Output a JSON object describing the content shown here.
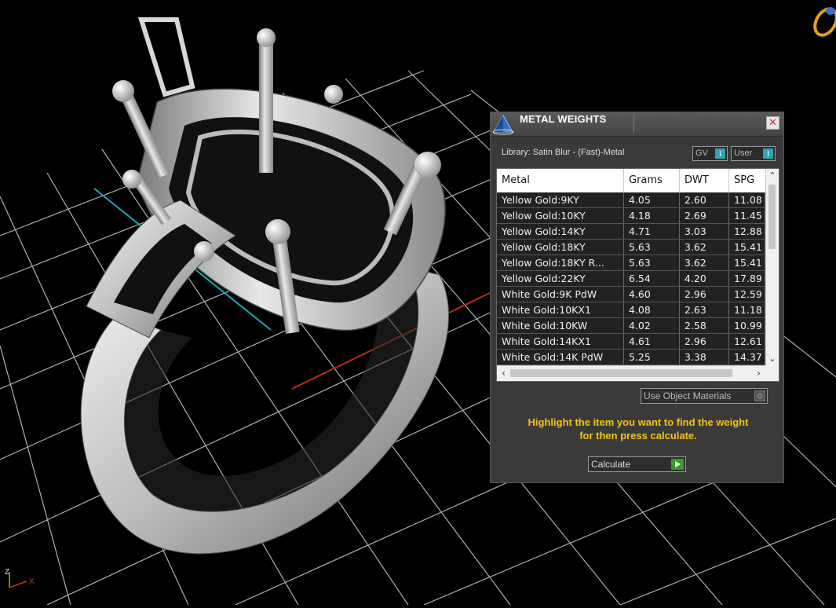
{
  "panel": {
    "title": "METAL WEIGHTS",
    "close_label": "✕",
    "library_label": "Library: Satin Blur - (Fast)-Metal",
    "gv_label": "GV",
    "user_label": "User",
    "columns": [
      "Metal",
      "Grams",
      "DWT",
      "SPG"
    ],
    "rows": [
      {
        "metal": "Yellow Gold:9KY",
        "grams": "4.05",
        "dwt": "2.60",
        "spg": "11.08"
      },
      {
        "metal": "Yellow Gold:10KY",
        "grams": "4.18",
        "dwt": "2.69",
        "spg": "11.45"
      },
      {
        "metal": "Yellow Gold:14KY",
        "grams": "4.71",
        "dwt": "3.03",
        "spg": "12.88"
      },
      {
        "metal": "Yellow Gold:18KY",
        "grams": "5.63",
        "dwt": "3.62",
        "spg": "15.41"
      },
      {
        "metal": "Yellow Gold:18KY R...",
        "grams": "5.63",
        "dwt": "3.62",
        "spg": "15.41"
      },
      {
        "metal": "Yellow Gold:22KY",
        "grams": "6.54",
        "dwt": "4.20",
        "spg": "17.89"
      },
      {
        "metal": "White Gold:9K PdW",
        "grams": "4.60",
        "dwt": "2.96",
        "spg": "12.59"
      },
      {
        "metal": "White Gold:10KX1",
        "grams": "4.08",
        "dwt": "2.63",
        "spg": "11.18"
      },
      {
        "metal": "White Gold:10KW",
        "grams": "4.02",
        "dwt": "2.58",
        "spg": "10.99"
      },
      {
        "metal": "White Gold:14KX1",
        "grams": "4.61",
        "dwt": "2.96",
        "spg": "12.61"
      },
      {
        "metal": "White Gold:14K PdW",
        "grams": "5.25",
        "dwt": "3.38",
        "spg": "14.37"
      }
    ],
    "materials_dropdown": "Use Object Materials",
    "hint_line1": "Highlight the item you want to find the weight",
    "hint_line2": "for then press calculate.",
    "calculate_label": "Calculate"
  },
  "viewport": {
    "axis_z": "Z",
    "axis_x": "X"
  },
  "colors": {
    "hint": "#f2c318",
    "toggle_on": "#2fa6b0",
    "play": "#3a9a2a",
    "grid": "#cfcfcf",
    "x_axis": "#b82a1a",
    "y_axis": "#1fa6b8"
  }
}
